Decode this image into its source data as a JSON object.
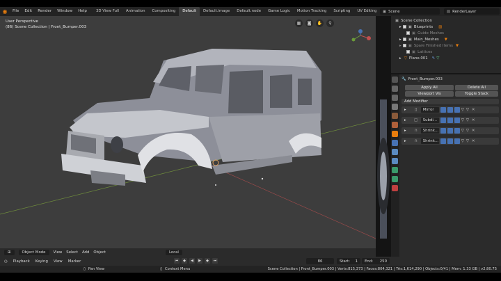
{
  "menu": [
    "File",
    "Edit",
    "Render",
    "Window",
    "Help"
  ],
  "workspaces": [
    "3D View Full",
    "Animation",
    "Compositing",
    "Default",
    "Default.image",
    "Default.node",
    "Game Logic",
    "Motion Tracking",
    "Scripting",
    "UV Editing",
    "Video Editing"
  ],
  "active_workspace": "Default",
  "scene_name": "Scene",
  "render_layer": "RenderLayer",
  "viewport": {
    "title": "User Perspective",
    "subtitle": "(86) Scene Collection | Front_Bumper.003",
    "mode": "Object Mode",
    "menus": [
      "View",
      "Select",
      "Add",
      "Object"
    ],
    "orientation": "Local"
  },
  "outliner": {
    "root": "Scene Collection",
    "items": [
      {
        "name": "Blueprints",
        "dim": false
      },
      {
        "name": "Guide Meshes",
        "dim": true
      },
      {
        "name": "Main_Meshes",
        "dim": false
      },
      {
        "name": "Spare Finished Items",
        "dim": true
      },
      {
        "name": "Lattices",
        "dim": true
      },
      {
        "name": "Plane.001",
        "dim": false
      }
    ]
  },
  "properties": {
    "object_name": "Front_Bumper.003",
    "apply_all": "Apply All",
    "delete_all": "Delete All",
    "viewport_vis": "Viewport Vis",
    "toggle_stack": "Toggle Stack",
    "add_modifier": "Add Modifier",
    "modifiers": [
      "Mirror",
      "Subdi...",
      "Shrink...",
      "Shrink..."
    ]
  },
  "timeline": {
    "menus": [
      "Playback",
      "Keying",
      "View",
      "Marker"
    ],
    "current_frame": "86",
    "start_label": "Start:",
    "start": "1",
    "end_label": "End:",
    "end": "250"
  },
  "statusbar": {
    "pan": "Pan View",
    "context": "Context Menu",
    "stats": "Scene Collection | Front_Bumper.003 | Verts:815,373 | Faces:804,321 | Tris:1,614,290 | Objects:0/41 | Mem: 1.33 GB | v2.80.75"
  },
  "colors": {
    "accent_blue": "#4772b3",
    "blender_orange": "#e87d0d",
    "viewport_bg": "#3d3d3d"
  }
}
